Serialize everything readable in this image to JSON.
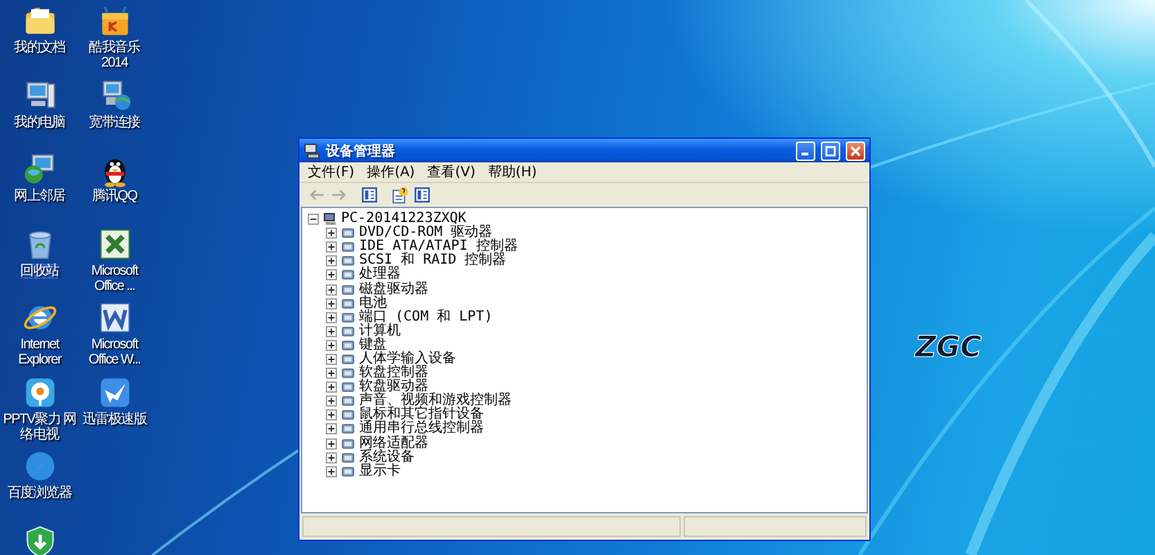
{
  "desktop": {
    "columns": [
      [
        {
          "label": "我的文档",
          "kind": "documents",
          "selected": false
        },
        {
          "label": "我的电脑",
          "kind": "computer",
          "selected": false
        },
        {
          "label": "网上邻居",
          "kind": "network",
          "selected": false
        },
        {
          "label": "回收站",
          "kind": "recycle",
          "selected": true
        },
        {
          "label": "Internet Explorer",
          "kind": "ie",
          "selected": false
        },
        {
          "label": "PPTV聚力 网络电视",
          "kind": "pptv",
          "selected": false
        },
        {
          "label": "百度浏览器",
          "kind": "browser",
          "selected": false
        },
        {
          "kind": "shield",
          "selected": false
        }
      ],
      [
        {
          "label": "酷我音乐 2014",
          "kind": "music",
          "selected": false
        },
        {
          "label": "宽带连接",
          "kind": "broadband",
          "selected": false
        },
        {
          "label": "腾讯QQ",
          "kind": "qq",
          "selected": false
        },
        {
          "label": "Microsoft Office ...",
          "kind": "excel",
          "selected": false
        },
        {
          "label": "Microsoft Office W...",
          "kind": "word",
          "selected": false
        },
        {
          "label": "迅雷极速版",
          "kind": "bird",
          "selected": false
        }
      ]
    ],
    "wallpaper_text": "ZGC"
  },
  "window": {
    "title": "设备管理器",
    "menu": [
      "文件(F)",
      "操作(A)",
      "查看(V)",
      "帮助(H)"
    ],
    "toolbar": [
      {
        "kind": "back",
        "disabled": true
      },
      {
        "kind": "forward",
        "disabled": true
      },
      {
        "kind": "panel",
        "disabled": false
      },
      {
        "kind": "properties",
        "disabled": false
      },
      {
        "kind": "panel",
        "disabled": false
      }
    ],
    "tree": {
      "label": "PC-20141223ZXQK",
      "expanded": true,
      "children": [
        {
          "label": "DVD/CD-ROM 驱动器",
          "expanded": false
        },
        {
          "label": "IDE ATA/ATAPI 控制器",
          "expanded": false
        },
        {
          "label": "SCSI 和 RAID 控制器",
          "expanded": false
        },
        {
          "label": "处理器",
          "expanded": false
        },
        {
          "label": "磁盘驱动器",
          "expanded": false
        },
        {
          "label": "电池",
          "expanded": false
        },
        {
          "label": "端口 (COM 和 LPT)",
          "expanded": false
        },
        {
          "label": "计算机",
          "expanded": false
        },
        {
          "label": "键盘",
          "expanded": false
        },
        {
          "label": "人体学输入设备",
          "expanded": false
        },
        {
          "label": "软盘控制器",
          "expanded": false
        },
        {
          "label": "软盘驱动器",
          "expanded": false
        },
        {
          "label": "声音、视频和游戏控制器",
          "expanded": false
        },
        {
          "label": "鼠标和其它指针设备",
          "expanded": false
        },
        {
          "label": "通用串行总线控制器",
          "expanded": false
        },
        {
          "label": "网络适配器",
          "expanded": false
        },
        {
          "label": "系统设备",
          "expanded": false
        },
        {
          "label": "显示卡",
          "expanded": false
        }
      ]
    }
  }
}
